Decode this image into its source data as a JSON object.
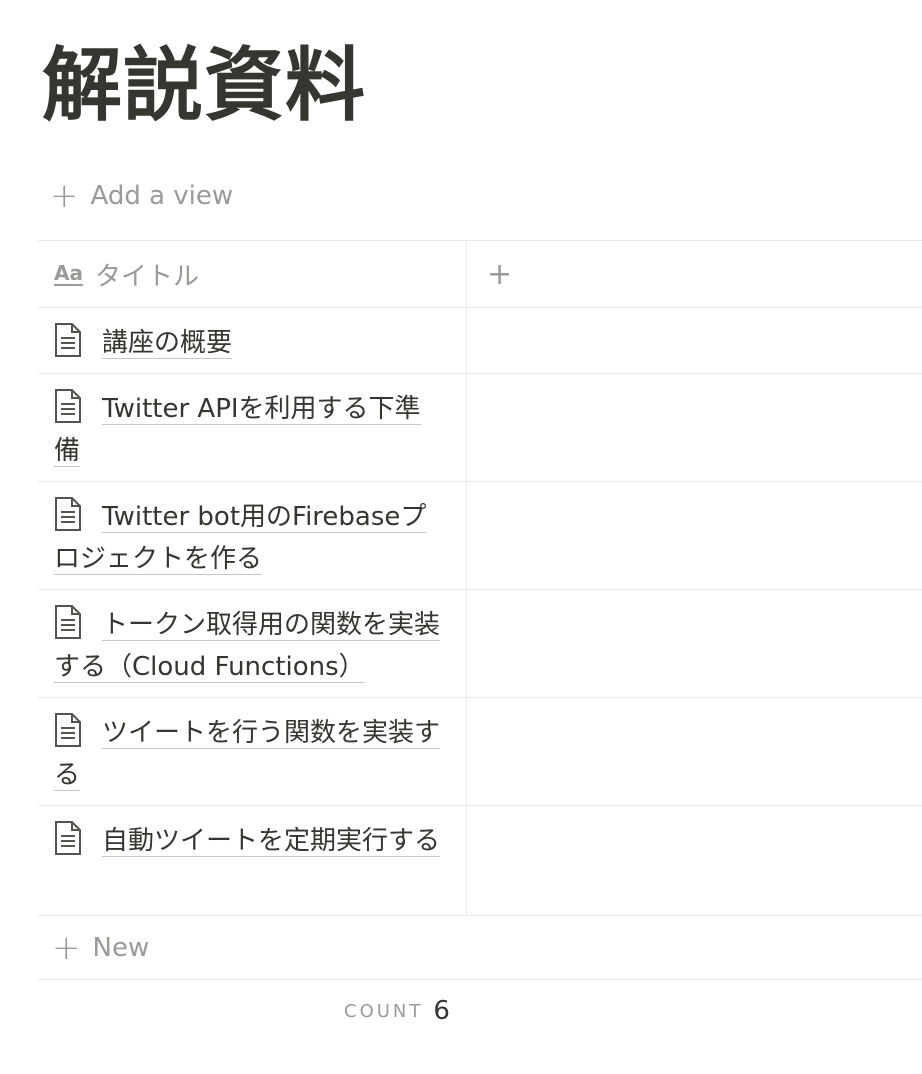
{
  "page": {
    "title": "解説資料"
  },
  "toolbar": {
    "add_view_label": "Add a view",
    "add_view_icon": "plus-icon"
  },
  "table": {
    "columns": [
      {
        "label": "タイトル",
        "icon": "text-property-icon"
      },
      {
        "label": "",
        "icon": "plus-icon"
      }
    ],
    "rows": [
      {
        "title": "講座の概要",
        "icon": "page-icon"
      },
      {
        "title": "Twitter APIを利用する下準備",
        "icon": "page-icon"
      },
      {
        "title": "Twitter bot用のFirebaseプロジェクトを作る",
        "icon": "page-icon"
      },
      {
        "title": "トークン取得用の関数を実装する（Cloud Functions）",
        "icon": "page-icon"
      },
      {
        "title": "ツイートを行う関数を実装する",
        "icon": "page-icon"
      },
      {
        "title": "自動ツイートを定期実行する",
        "icon": "page-icon"
      }
    ],
    "new_label": "New"
  },
  "footer": {
    "count_label": "COUNT",
    "count_value": "6"
  },
  "colors": {
    "text": "#37352f",
    "muted": "#9b9a97",
    "border": "#e9e9e7"
  }
}
